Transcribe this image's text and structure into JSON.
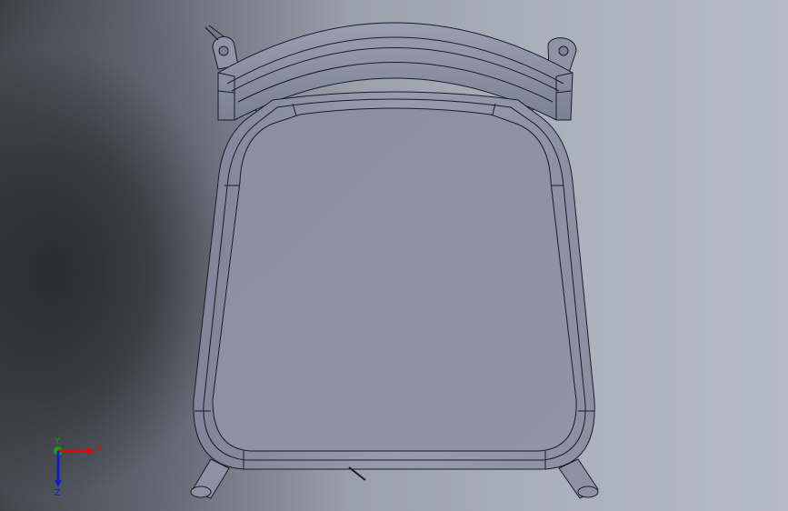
{
  "viewport": {
    "model_name": "chair-top-view"
  },
  "triad": {
    "x_label": "X",
    "y_label": "Y",
    "z_label": "Z",
    "x_color": "#d01010",
    "y_color": "#10a010",
    "z_color": "#1020c0"
  },
  "colors": {
    "part_fill": "#8b90a3",
    "edge": "#1a1c24"
  }
}
